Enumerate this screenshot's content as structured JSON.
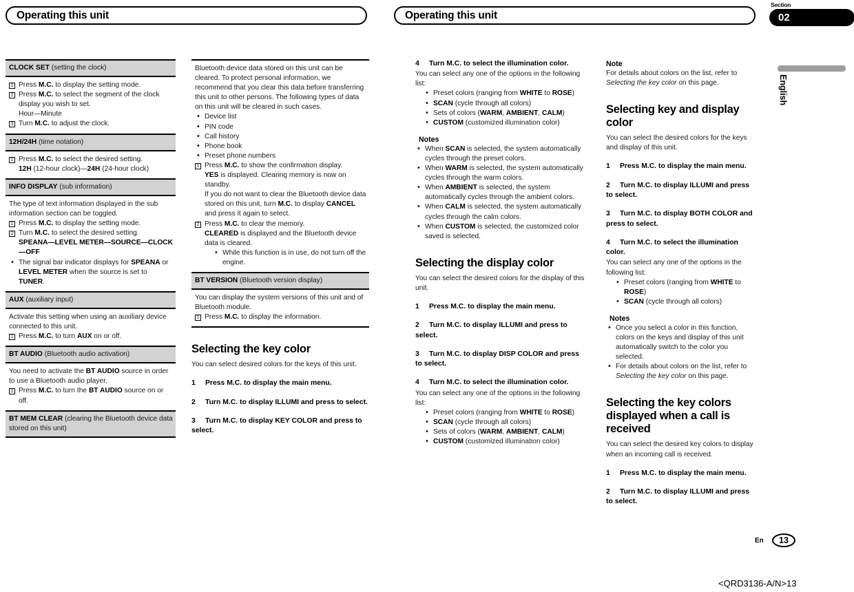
{
  "header": {
    "left_title": "Operating this unit",
    "right_title": "Operating this unit",
    "section_label": "Section",
    "section_number": "02",
    "language": "English"
  },
  "footer": {
    "lang_code": "En",
    "page_number": "13",
    "doc_code": "<QRD3136-A/N>13"
  },
  "col1": {
    "clock_set": {
      "title_bold": "CLOCK SET",
      "title_rest": "(setting the clock)",
      "step1_pre": "Press ",
      "step1_b": "M.C.",
      "step1_post": " to display the setting mode.",
      "step2_pre": "Press ",
      "step2_b": "M.C.",
      "step2_post": " to select the segment of the clock display you wish to set.",
      "step2_sub": "Hour—Minute",
      "step3_pre": "Turn ",
      "step3_b": "M.C.",
      "step3_post": " to adjust the clock."
    },
    "time_notation": {
      "title_bold": "12H/24H",
      "title_rest": "(time notation)",
      "step1_pre": "Press ",
      "step1_b": "M.C.",
      "step1_post": " to select the desired setting.",
      "opt_b1": "12H",
      "opt_t1": " (12-hour clock)—",
      "opt_b2": "24H",
      "opt_t2": " (24-hour clock)"
    },
    "info_display": {
      "title_bold": "INFO DISPLAY",
      "title_rest": "(sub information)",
      "intro": "The type of text information displayed in the sub information section can be toggled.",
      "step1_pre": "Press ",
      "step1_b": "M.C.",
      "step1_post": " to display the setting mode.",
      "step2_pre": "Turn ",
      "step2_b": "M.C.",
      "step2_post": " to select the desired setting.",
      "step2_opts": "SPEANA—LEVEL METER—SOURCE—CLOCK—OFF",
      "bullet1_a": "The signal bar indicator displays for ",
      "bullet1_b1": "SPEANA",
      "bullet1_c": " or ",
      "bullet1_b2": "LEVEL METER",
      "bullet1_d": " when the source is set to ",
      "bullet1_b3": "TUNER",
      "bullet1_e": "."
    },
    "aux": {
      "title_bold": "AUX",
      "title_rest": "(auxiliary input)",
      "intro": "Activate this setting when using an auxiliary device connected to this unit.",
      "step1_pre": "Press ",
      "step1_b": "M.C.",
      "step1_mid": " to turn ",
      "step1_b2": "AUX",
      "step1_post": " on or off."
    },
    "bt_audio": {
      "title_bold": "BT AUDIO",
      "title_rest": "(Bluetooth audio activation)",
      "intro_a": "You need to activate the ",
      "intro_b": "BT AUDIO",
      "intro_c": " source in order to use a Bluetooth audio player.",
      "step1_pre": "Press ",
      "step1_b": "M.C.",
      "step1_mid": " to turn the ",
      "step1_b2": "BT AUDIO",
      "step1_post": " source on or off."
    },
    "bt_mem_clear": {
      "title_bold": "BT MEM CLEAR",
      "title_rest": "(clearing the Bluetooth device data stored on this unit)"
    }
  },
  "col2": {
    "intro": "Bluetooth device data stored on this unit can be cleared. To protect personal information, we recommend that you clear this data before transferring this unit to other persons. The following types of data on this unit will be cleared in such cases.",
    "bullets": [
      "Device list",
      "PIN code",
      "Call history",
      "Phone book",
      "Preset phone numbers"
    ],
    "step1_pre": "Press ",
    "step1_b": "M.C.",
    "step1_post": " to show the confirmation display.",
    "step1_l2_b": "YES",
    "step1_l2_t": " is displayed. Clearing memory is now on standby.",
    "step1_l3_a": "If you do not want to clear the Bluetooth device data stored on this unit, turn ",
    "step1_l3_b": "M.C.",
    "step1_l3_c": " to display ",
    "step1_l3_b2": "CANCEL",
    "step1_l3_d": " and press it again to select.",
    "step2_pre": "Press ",
    "step2_b": "M.C.",
    "step2_post": " to clear the memory.",
    "step2_l2_b": "CLEARED",
    "step2_l2_t": " is displayed and the Bluetooth device data is cleared.",
    "step2_bullet": "While this function is in use, do not turn off the engine.",
    "bt_version": {
      "title_bold": "BT VERSION",
      "title_rest": "(Bluetooth version display)",
      "intro": "You can display the system versions of this unit and of Bluetooth module.",
      "step1_pre": "Press ",
      "step1_b": "M.C.",
      "step1_post": " to display the information."
    },
    "key_color": {
      "heading": "Selecting the key color",
      "intro": "You can select desired colors for the keys of this unit.",
      "steps": [
        {
          "n": "1",
          "text": "Press M.C. to display the main menu."
        },
        {
          "n": "2",
          "text": "Turn M.C. to display ILLUMI and press to select."
        },
        {
          "n": "3",
          "text": "Turn M.C. to display KEY COLOR and press to select."
        }
      ]
    }
  },
  "col3": {
    "step4": {
      "n": "4",
      "text": "Turn M.C. to select the illumination color.",
      "intro": "You can select any one of the options in the following list:",
      "opts": [
        {
          "a": "Preset colors (ranging from ",
          "b1": "WHITE",
          "c": " to ",
          "b2": "ROSE",
          "d": ")"
        },
        {
          "b1": "SCAN",
          "d": " (cycle through all colors)"
        },
        {
          "a": "Sets of colors (",
          "b1": "WARM",
          "c": ", ",
          "b2": "AMBIENT",
          "c2": ", ",
          "b3": "CALM",
          "d": ")"
        },
        {
          "b1": "CUSTOM",
          "d": " (customized illumination color)"
        }
      ]
    },
    "notes_title": "Notes",
    "notes": [
      {
        "a": "When ",
        "b": "SCAN",
        "c": " is selected, the system automatically cycles through the preset colors."
      },
      {
        "a": "When ",
        "b": "WARM",
        "c": " is selected, the system automatically cycles through the warm colors."
      },
      {
        "a": "When ",
        "b": "AMBIENT",
        "c": " is selected, the system automatically cycles through the ambient colors."
      },
      {
        "a": "When ",
        "b": "CALM",
        "c": " is selected, the system automatically cycles through the calm colors."
      },
      {
        "a": "When ",
        "b": "CUSTOM",
        "c": " is selected, the customized color saved is selected."
      }
    ],
    "display_color": {
      "heading": "Selecting the display color",
      "intro": "You can select the desired colors for the display of this unit.",
      "steps": [
        {
          "n": "1",
          "text": "Press M.C. to display the main menu."
        },
        {
          "n": "2",
          "text": "Turn M.C. to display ILLUMI and press to select."
        },
        {
          "n": "3",
          "text": "Turn M.C. to display DISP COLOR and press to select."
        },
        {
          "n": "4",
          "text": "Turn M.C. to select the illumination color."
        }
      ],
      "step4_intro": "You can select any one of the options in the following list:",
      "opts": [
        {
          "a": "Preset colors (ranging from ",
          "b1": "WHITE",
          "c": " to ",
          "b2": "ROSE",
          "d": ")"
        },
        {
          "b1": "SCAN",
          "d": " (cycle through all colors)"
        },
        {
          "a": "Sets of colors (",
          "b1": "WARM",
          "c": ", ",
          "b2": "AMBIENT",
          "c2": ", ",
          "b3": "CALM",
          "d": ")"
        },
        {
          "b1": "CUSTOM",
          "d": " (customized illumination color)"
        }
      ]
    }
  },
  "col4": {
    "note_title": "Note",
    "note_a": "For details about colors on the list, refer to ",
    "note_i": "Selecting the key color",
    "note_c": " on this page.",
    "key_and_display": {
      "heading": "Selecting key and display color",
      "intro": "You can select the desired colors for the keys and display of this unit.",
      "steps": [
        {
          "n": "1",
          "text": "Press M.C. to display the main menu."
        },
        {
          "n": "2",
          "text": "Turn M.C. to display ILLUMI and press to select."
        },
        {
          "n": "3",
          "text": "Turn M.C. to display BOTH COLOR and press to select."
        },
        {
          "n": "4",
          "text": "Turn M.C. to select the illumination color."
        }
      ],
      "step4_intro": "You can select any one of the options in the following list:",
      "opts": [
        {
          "a": "Preset colors (ranging from ",
          "b1": "WHITE",
          "c": " to ",
          "b2": "ROSE",
          "d": ")"
        },
        {
          "b1": "SCAN",
          "d": " (cycle through all colors)"
        }
      ],
      "notes_title": "Notes",
      "note1": "Once you select a color in this function, colors on the keys and display of this unit automatically switch to the color you selected.",
      "note2_a": "For details about colors on the list, refer to ",
      "note2_i": "Selecting the key color",
      "note2_c": " on this page."
    },
    "call_colors": {
      "heading": "Selecting the key colors displayed when a call is received",
      "intro": "You can select the desired key colors to display when an incoming call is received.",
      "steps": [
        {
          "n": "1",
          "text": "Press M.C. to display the main menu."
        },
        {
          "n": "2",
          "text": "Turn M.C. to display ILLUMI and press to select."
        }
      ]
    }
  }
}
